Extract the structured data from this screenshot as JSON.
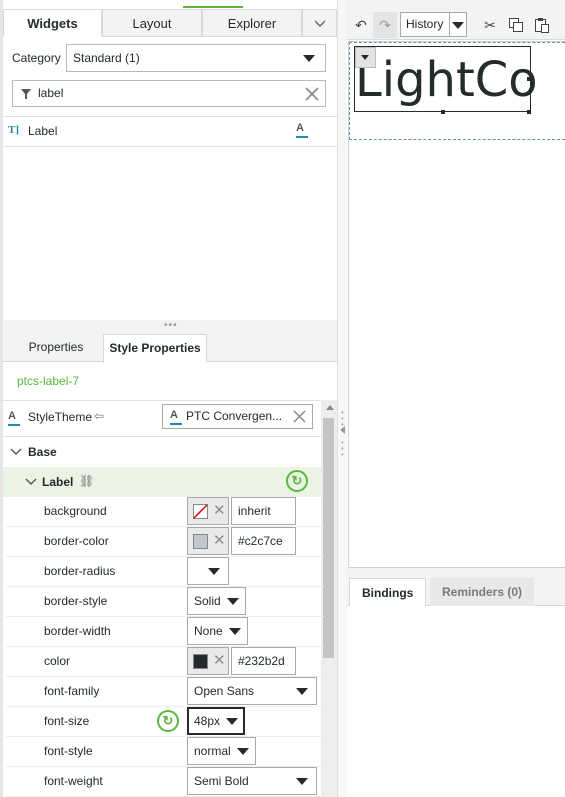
{
  "tabs": {
    "widgets": "Widgets",
    "layout": "Layout",
    "explorer": "Explorer"
  },
  "category": {
    "label": "Category",
    "value": "Standard (1)"
  },
  "search": {
    "value": "label"
  },
  "widget_list": [
    {
      "name": "Label"
    }
  ],
  "sub_tabs": {
    "properties": "Properties",
    "style_properties": "Style Properties"
  },
  "selected_id": "ptcs-label-7",
  "style_theme": {
    "label": "StyleTheme",
    "value": "PTC Convergen..."
  },
  "sections": {
    "base": "Base",
    "label": "Label"
  },
  "properties": {
    "background": {
      "name": "background",
      "value": "inherit"
    },
    "border_color": {
      "name": "border-color",
      "value": "#c2c7ce",
      "swatch": "#c2c7ce"
    },
    "border_radius": {
      "name": "border-radius"
    },
    "border_style": {
      "name": "border-style",
      "value": "Solid"
    },
    "border_width": {
      "name": "border-width",
      "value": "None"
    },
    "color": {
      "name": "color",
      "value": "#232b2d",
      "swatch": "#232b2d"
    },
    "font_family": {
      "name": "font-family",
      "value": "Open Sans"
    },
    "font_size": {
      "name": "font-size",
      "value": "48px"
    },
    "font_style": {
      "name": "font-style",
      "value": "normal"
    },
    "font_weight": {
      "name": "font-weight",
      "value": "Semi Bold"
    }
  },
  "toolbar": {
    "history": "History"
  },
  "canvas": {
    "label_text": "LightCo"
  },
  "bottom_tabs": {
    "bindings": "Bindings",
    "reminders": "Reminders (0)"
  },
  "colors": {
    "accent": "#5bb73b",
    "teal": "#1a8fa6",
    "text": "#232b2d"
  }
}
